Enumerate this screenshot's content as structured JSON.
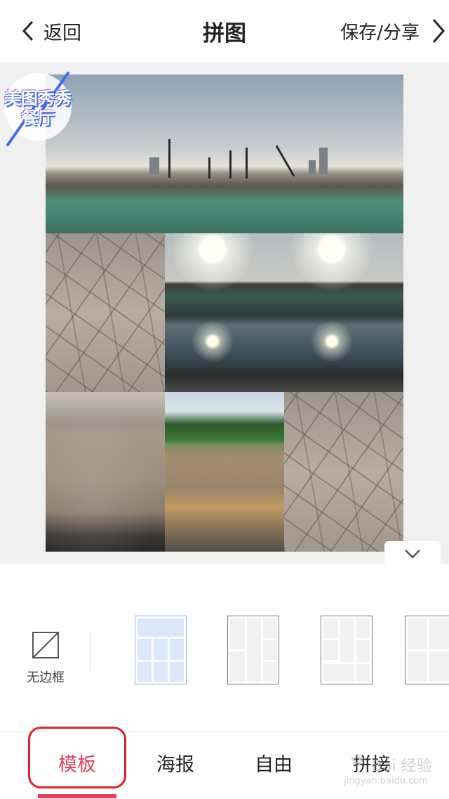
{
  "header": {
    "back_label": "返回",
    "title": "拼图",
    "save_label": "保存/分享"
  },
  "badge": {
    "line1": "美图秀秀",
    "line2": "餐厅"
  },
  "templates": {
    "no_frame_label": "无边框",
    "items": [
      {
        "name": "template-1",
        "selected": true
      },
      {
        "name": "template-2",
        "selected": false
      },
      {
        "name": "template-3",
        "selected": false
      },
      {
        "name": "template-4",
        "selected": false
      }
    ]
  },
  "tabs": [
    {
      "label": "模板",
      "active": true
    },
    {
      "label": "海报",
      "active": false
    },
    {
      "label": "自由",
      "active": false
    },
    {
      "label": "拼接",
      "active": false
    }
  ],
  "watermark": {
    "main": "Bai 经验",
    "sub": "jingyan.baidu.com"
  },
  "colors": {
    "accent": "#e04060",
    "canvas_bg": "#f0f0f0",
    "selected_template": "#8ab0ea"
  }
}
